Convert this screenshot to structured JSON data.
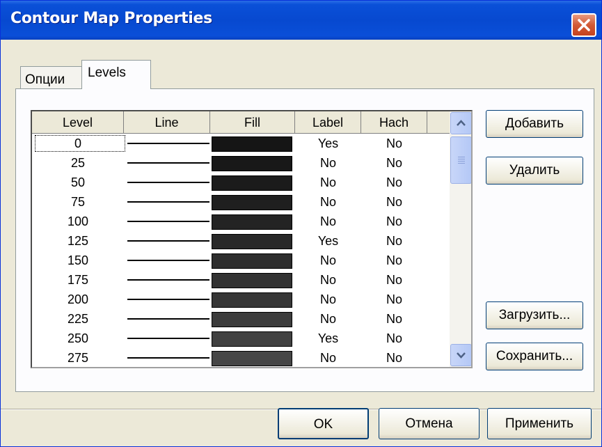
{
  "window": {
    "title": "Contour Map Properties"
  },
  "tabs": [
    {
      "label": "Опции"
    },
    {
      "label": "Levels"
    }
  ],
  "table": {
    "headers": [
      "Level",
      "Line",
      "Fill",
      "Label",
      "Hach"
    ],
    "rows": [
      {
        "level": "0",
        "label": "Yes",
        "hach": "No",
        "fill": "#151515"
      },
      {
        "level": "25",
        "label": "No",
        "hach": "No",
        "fill": "#181818"
      },
      {
        "level": "50",
        "label": "No",
        "hach": "No",
        "fill": "#1b1b1b"
      },
      {
        "level": "75",
        "label": "No",
        "hach": "No",
        "fill": "#1f1f1f"
      },
      {
        "level": "100",
        "label": "No",
        "hach": "No",
        "fill": "#232323"
      },
      {
        "level": "125",
        "label": "Yes",
        "hach": "No",
        "fill": "#282828"
      },
      {
        "level": "150",
        "label": "No",
        "hach": "No",
        "fill": "#2d2d2d"
      },
      {
        "level": "175",
        "label": "No",
        "hach": "No",
        "fill": "#323232"
      },
      {
        "level": "200",
        "label": "No",
        "hach": "No",
        "fill": "#373737"
      },
      {
        "level": "225",
        "label": "No",
        "hach": "No",
        "fill": "#3c3c3c"
      },
      {
        "level": "250",
        "label": "Yes",
        "hach": "No",
        "fill": "#414141"
      },
      {
        "level": "275",
        "label": "No",
        "hach": "No",
        "fill": "#464646"
      }
    ]
  },
  "side_buttons": {
    "add": "Добавить",
    "delete": "Удалить",
    "load": "Загрузить...",
    "save": "Сохранить..."
  },
  "footer": {
    "ok": "OK",
    "cancel": "Отмена",
    "apply": "Применить"
  },
  "icons": {
    "close": "close-icon",
    "scroll_up": "chevron-up-icon",
    "scroll_down": "chevron-down-icon",
    "grip": "scroll-grip-icon"
  }
}
